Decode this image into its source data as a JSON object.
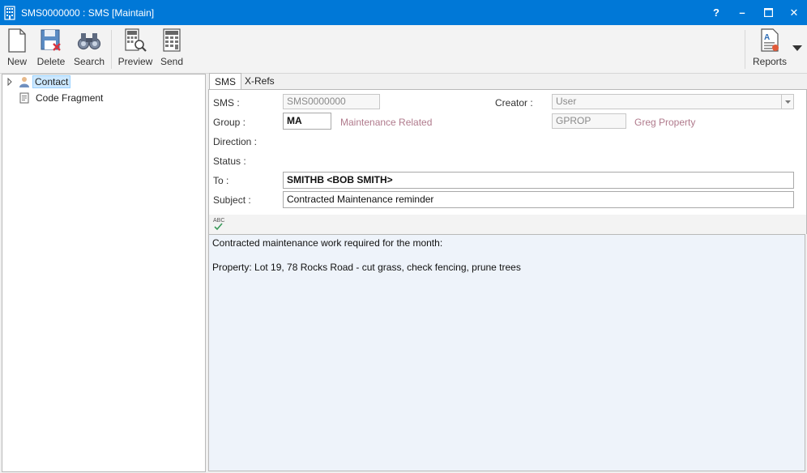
{
  "window": {
    "title": "SMS0000000 : SMS [Maintain]",
    "controls": {
      "help": "?",
      "minimize": "–",
      "maximize": "☐",
      "close": "✕"
    }
  },
  "toolbar": {
    "new_label": "New",
    "delete_label": "Delete",
    "search_label": "Search",
    "preview_label": "Preview",
    "send_label": "Send",
    "reports_label": "Reports"
  },
  "tree": {
    "items": [
      {
        "label": "Contact"
      },
      {
        "label": "Code Fragment"
      }
    ]
  },
  "tabs": [
    {
      "label": "SMS"
    },
    {
      "label": "X-Refs"
    }
  ],
  "form": {
    "sms_label": "SMS :",
    "sms_value": "SMS0000000",
    "creator_label": "Creator :",
    "creator_value": "User",
    "group_label": "Group :",
    "group_code": "MA",
    "group_desc": "Maintenance Related",
    "creator_code": "GPROP",
    "creator_desc": "Greg Property",
    "direction_label": "Direction :",
    "status_label": "Status :",
    "to_label": "To :",
    "to_value": "SMITHB <BOB SMITH>",
    "subject_label": "Subject :",
    "subject_value": "Contracted Maintenance reminder"
  },
  "spell": {
    "icon_text": "ABC"
  },
  "message": {
    "line1": "Contracted maintenance work required for the month:",
    "line2": "",
    "line3": "Property: Lot 19, 78 Rocks Road - cut grass, check fencing, prune trees"
  },
  "colors": {
    "titlebar": "#0078d7",
    "desc_text": "#b07a8c",
    "body_bg": "#eef3fa"
  }
}
